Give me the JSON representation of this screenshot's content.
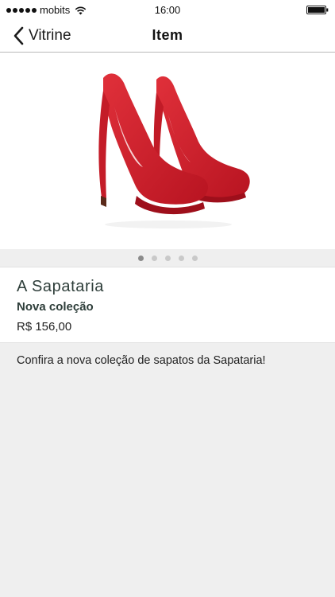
{
  "status_bar": {
    "carrier": "mobits",
    "time": "16:00",
    "signal_icon": "signal-dots",
    "wifi_icon": "wifi-icon",
    "battery_icon": "battery-icon"
  },
  "nav": {
    "back_label": "Vitrine",
    "back_icon": "chevron-left-icon",
    "title": "Item"
  },
  "carousel": {
    "image": "red-suede-high-heel-pumps",
    "page_count": 5,
    "active_page": 1
  },
  "item": {
    "store_name": "A Sapataria",
    "name": "Nova coleção",
    "price": "R$ 156,00",
    "description": "Confira a nova coleção de sapatos da Sapataria!"
  },
  "colors": {
    "background": "#efefef",
    "card": "#ffffff",
    "title_text": "#2e3e3a",
    "shoe_red": "#d41f2c",
    "pager_active": "#8b8b8b",
    "pager_inactive": "#c9c9c9"
  }
}
